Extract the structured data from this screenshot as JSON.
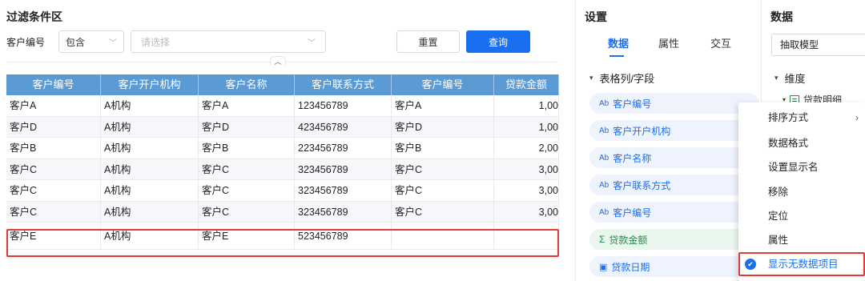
{
  "filter": {
    "title": "过滤条件区",
    "field_label": "客户编号",
    "operator": "包含",
    "value_placeholder": "请选择",
    "reset_label": "重置",
    "query_label": "查询",
    "collapse_icon": "chevron-up-icon"
  },
  "table": {
    "columns": [
      "客户编号",
      "客户开户机构",
      "客户名称",
      "客户联系方式",
      "客户编号",
      "贷款金额"
    ],
    "rows": [
      [
        "客户A",
        "A机构",
        "客户A",
        "123456789",
        "客户A",
        "1,00"
      ],
      [
        "客户D",
        "A机构",
        "客户D",
        "423456789",
        "客户D",
        "1,00"
      ],
      [
        "客户B",
        "A机构",
        "客户B",
        "223456789",
        "客户B",
        "2,00"
      ],
      [
        "客户C",
        "A机构",
        "客户C",
        "323456789",
        "客户C",
        "3,00"
      ],
      [
        "客户C",
        "A机构",
        "客户C",
        "323456789",
        "客户C",
        "3,00"
      ],
      [
        "客户C",
        "A机构",
        "客户C",
        "323456789",
        "客户C",
        "3,00"
      ],
      [
        "客户E",
        "A机构",
        "客户E",
        "523456789",
        "",
        ""
      ]
    ]
  },
  "settings": {
    "title": "设置",
    "tabs": [
      "数据",
      "属性",
      "交互"
    ],
    "active_tab": "数据",
    "section": "表格列/字段",
    "fields": [
      {
        "icon": "text-field-icon",
        "prefix": "Ab",
        "label": "客户编号"
      },
      {
        "icon": "text-field-icon",
        "prefix": "Ab",
        "label": "客户开户机构"
      },
      {
        "icon": "text-field-icon",
        "prefix": "Ab",
        "label": "客户名称"
      },
      {
        "icon": "text-field-icon",
        "prefix": "Ab",
        "label": "客户联系方式"
      },
      {
        "icon": "text-field-icon",
        "prefix": "Ab",
        "label": "客户编号"
      },
      {
        "icon": "sum-icon",
        "prefix": "Σ",
        "label": "贷款金额"
      },
      {
        "icon": "date-icon",
        "prefix": "▣",
        "label": "贷款日期"
      }
    ]
  },
  "data_panel": {
    "title": "数据",
    "model": "抽取模型",
    "dimension": "维度",
    "tree_item": "贷款明细"
  },
  "context_menu": {
    "items": [
      "排序方式",
      "数据格式",
      "设置显示名",
      "移除",
      "定位",
      "属性",
      "显示无数据项目"
    ],
    "checked_item": "显示无数据项目"
  },
  "colors": {
    "accent": "#1a6ff0",
    "header": "#5b9bd5",
    "highlight": "#e03a3a"
  }
}
